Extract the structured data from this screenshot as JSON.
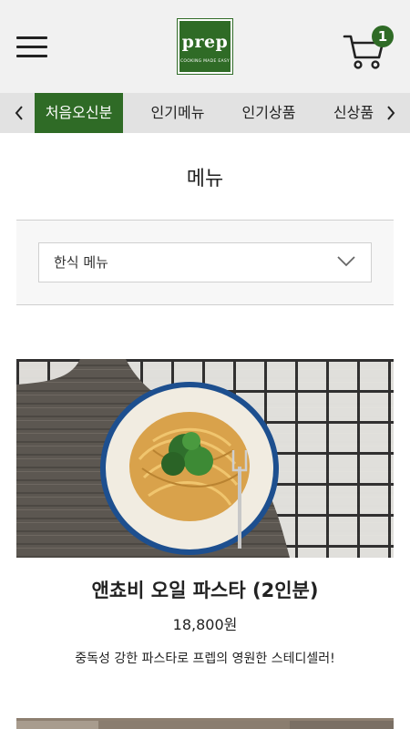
{
  "header": {
    "menu_icon": "hamburger-menu-icon",
    "logo": {
      "word": "prep",
      "tagline": "COOKING MADE EASY"
    },
    "cart_icon": "shopping-cart-icon",
    "cart_count": "1"
  },
  "category_nav": {
    "prev_icon": "chevron-left-icon",
    "next_icon": "chevron-right-icon",
    "tabs": [
      {
        "label": "처음오신분",
        "active": true
      },
      {
        "label": "인기메뉴",
        "active": false
      },
      {
        "label": "인기상품",
        "active": false
      },
      {
        "label": "신상품",
        "active": false
      }
    ]
  },
  "page_title": "메뉴",
  "filter": {
    "selected": "한식 메뉴",
    "icon": "chevron-down-icon"
  },
  "products": [
    {
      "name": "앤쵸비 오일 파스타 (2인분)",
      "price": "18,800원",
      "description": "중독성 강한 파스타로 프렙의 영원한 스테디셀러!"
    }
  ],
  "colors": {
    "brand_green": "#2f6b26",
    "header_bg": "#f1f1f1",
    "nav_bg": "#e2e2e2"
  }
}
